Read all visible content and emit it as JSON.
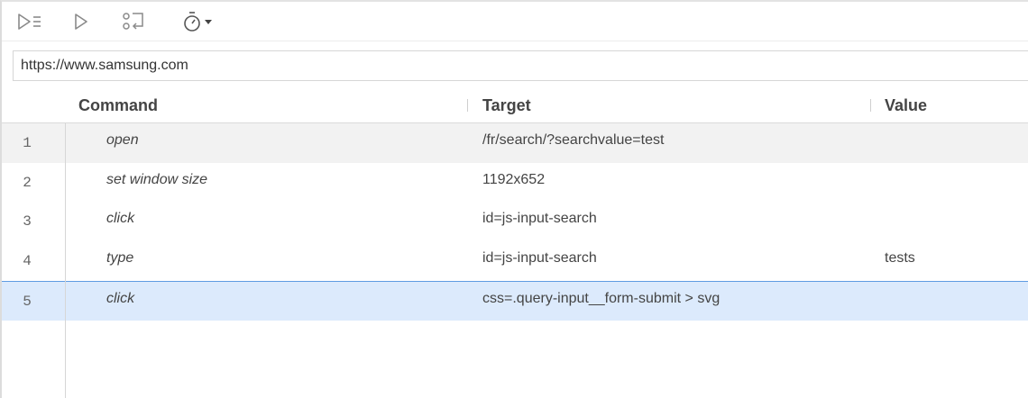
{
  "toolbar": {
    "run_all_icon": "play-all-icon",
    "run_icon": "play-icon",
    "step_icon": "step-over-icon",
    "speed_icon": "stopwatch-icon",
    "speed_dropdown_icon": "caret-down-icon"
  },
  "url_bar": {
    "value": "https://www.samsung.com"
  },
  "columns": {
    "command": "Command",
    "target": "Target",
    "value": "Value"
  },
  "rows": [
    {
      "num": "1",
      "command": "open",
      "target": "/fr/search/?searchvalue=test",
      "value": ""
    },
    {
      "num": "2",
      "command": "set window size",
      "target": "1192x652",
      "value": ""
    },
    {
      "num": "3",
      "command": "click",
      "target": "id=js-input-search",
      "value": ""
    },
    {
      "num": "4",
      "command": "type",
      "target": "id=js-input-search",
      "value": "tests"
    },
    {
      "num": "5",
      "command": "click",
      "target": "css=.query-input__form-submit > svg",
      "value": ""
    }
  ],
  "colors": {
    "selected_row_bg": "#dceafc",
    "selected_row_border": "#5f9be2",
    "first_row_bg": "#f2f2f2",
    "icon_gray": "#8a8a8a"
  }
}
